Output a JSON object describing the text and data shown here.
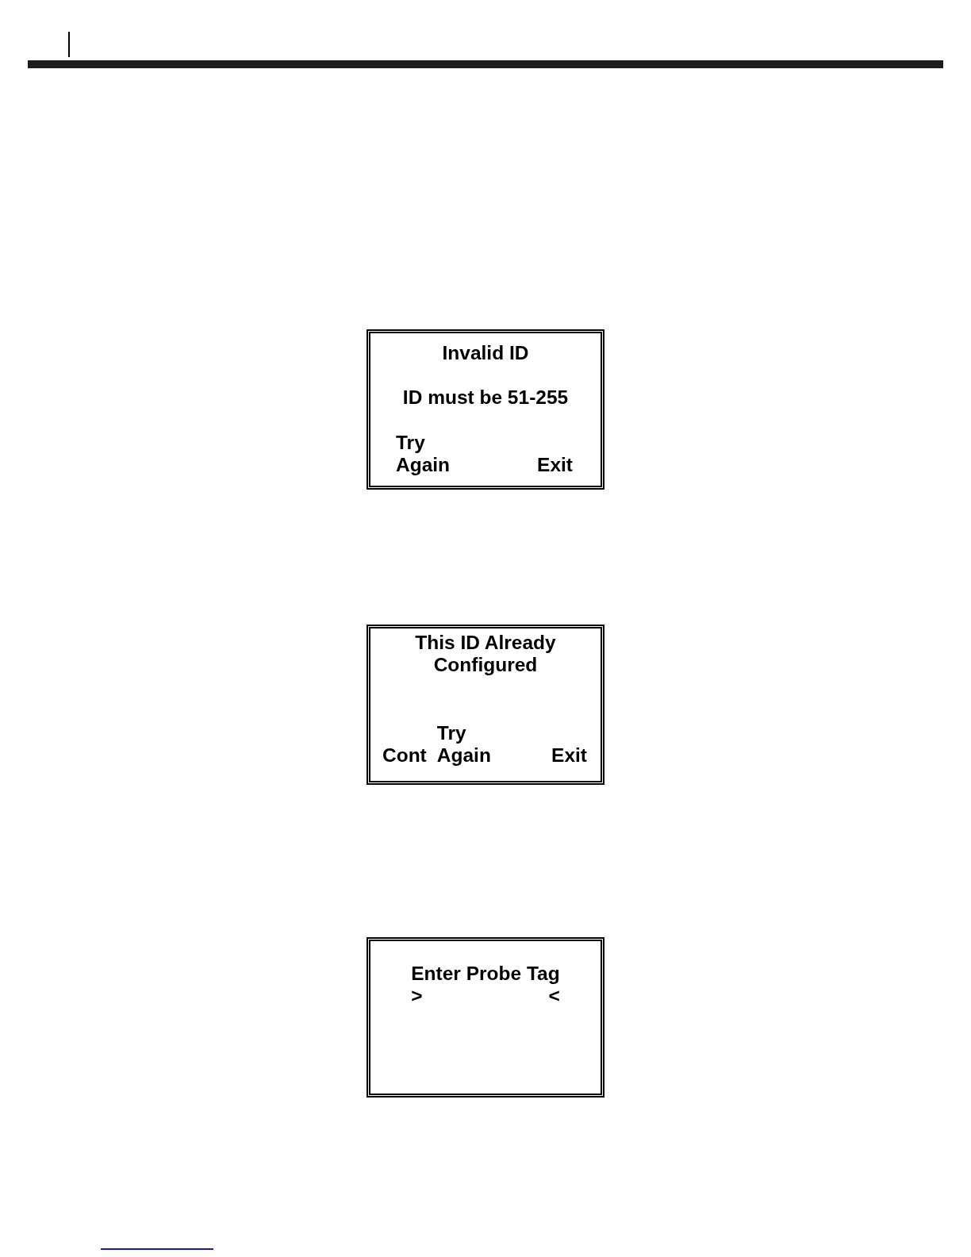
{
  "screens": [
    {
      "kind": "alert",
      "title": [
        "Invalid ID"
      ],
      "message": "ID must be 51-255",
      "softkeys": [
        {
          "label": [
            "Try",
            "Again"
          ]
        },
        {
          "label": [
            "Exit"
          ]
        }
      ]
    },
    {
      "kind": "alert",
      "title": [
        "This ID Already",
        "Configured"
      ],
      "softkeys": [
        {
          "label": [
            "Cont"
          ]
        },
        {
          "label": [
            "Try",
            "Again"
          ]
        },
        {
          "label": [
            "Exit"
          ]
        }
      ]
    },
    {
      "kind": "prompt",
      "prompt": "Enter Probe Tag",
      "entry_field": {
        "open_mark": ">",
        "close_mark": "<"
      }
    }
  ]
}
